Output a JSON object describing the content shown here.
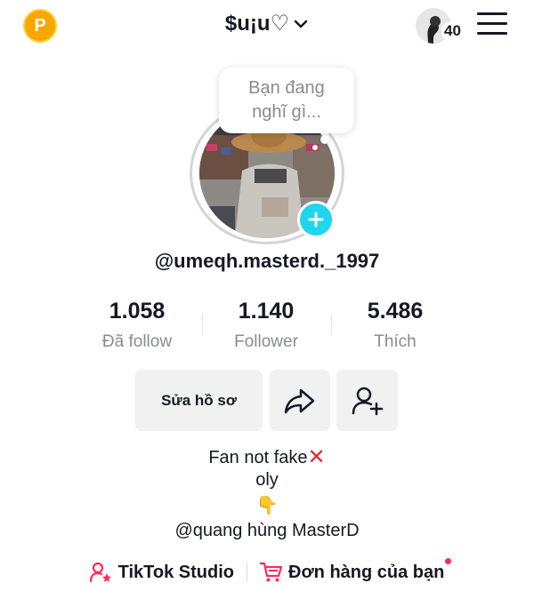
{
  "header": {
    "coin_symbol": "P",
    "username_title": "$u¡u♡",
    "friends_count": "40",
    "icons": {
      "coin": "coin-icon",
      "dropdown": "chevron-down-icon",
      "friends": "friends-avatar-icon",
      "menu": "hamburger-menu-icon"
    }
  },
  "profile": {
    "thought_bubble": "Bạn đang nghĩ gì...",
    "handle": "@umeqh.masterd._1997",
    "stats": [
      {
        "value": "1.058",
        "label": "Đã follow"
      },
      {
        "value": "1.140",
        "label": "Follower"
      },
      {
        "value": "5.486",
        "label": "Thích"
      }
    ]
  },
  "actions": {
    "edit_label": "Sửa hồ sơ",
    "icons": {
      "share": "share-arrow-icon",
      "add_friend": "add-friend-icon"
    }
  },
  "bio": {
    "line1": "Fan not fake",
    "line1_emoji": "✕",
    "line2": "oly",
    "line3_emoji": "👇",
    "line4": "@quang hùng MasterD"
  },
  "links": {
    "studio": "TikTok Studio",
    "orders": "Đơn hàng của bạn"
  },
  "colors": {
    "accent_cyan": "#20d5ec",
    "accent_red": "#fe2c55",
    "coin": "#f7a800",
    "text_secondary": "#8a8b91"
  }
}
